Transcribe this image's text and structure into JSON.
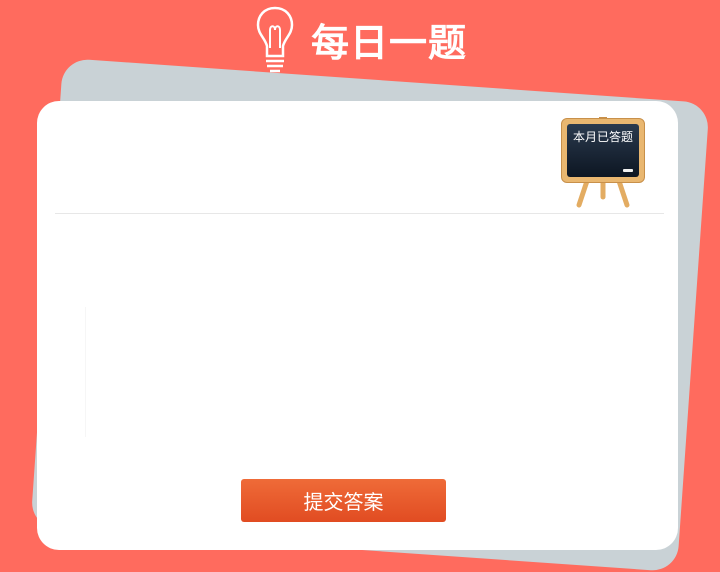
{
  "header": {
    "title": "每日一题",
    "icon": "lightbulb-icon"
  },
  "card": {
    "badge_label": "本月已答题",
    "badge_icon": "chalkboard-icon"
  },
  "actions": {
    "submit_label": "提交答案"
  },
  "colors": {
    "background": "#ff6b5e",
    "back_card": "#c9d2d6",
    "card": "#ffffff",
    "button": "#e8592c"
  }
}
